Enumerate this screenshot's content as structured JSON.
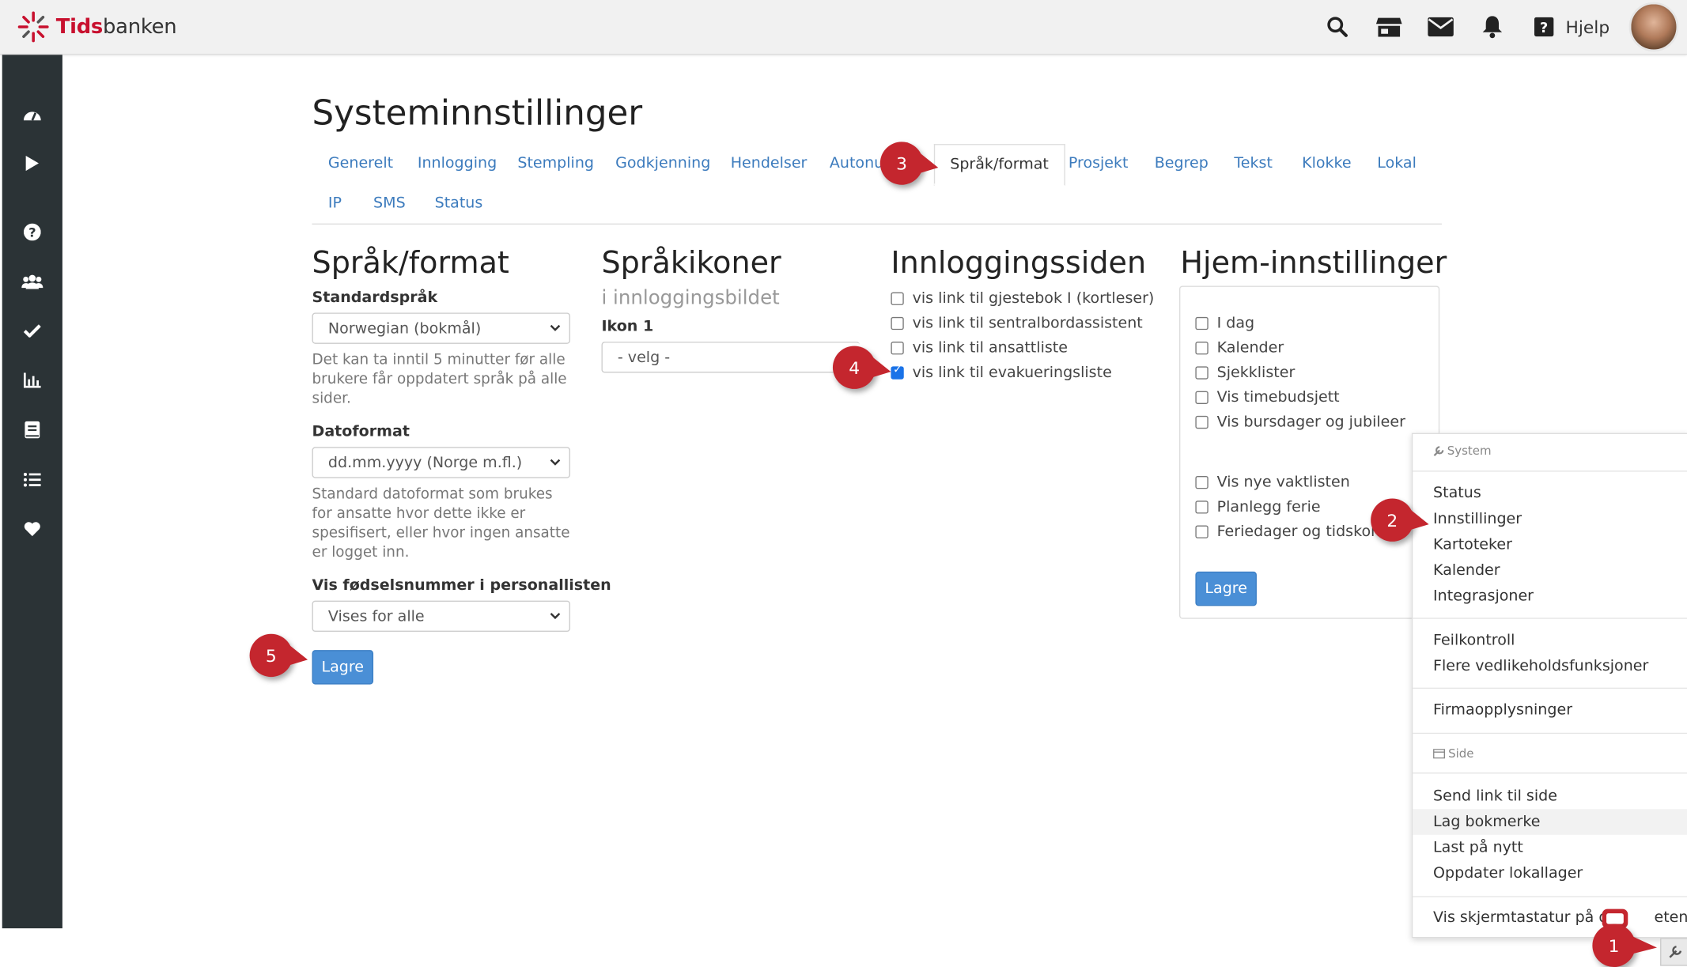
{
  "app": {
    "logo_text_a": "Tids",
    "logo_text_b": "banken",
    "help_label": "Hjelp"
  },
  "page": {
    "title": "Systeminnstillinger"
  },
  "tabs": [
    "Generelt",
    "Innlogging",
    "Stempling",
    "Godkjenning",
    "Hendelser",
    "Autonu",
    "Språk/format",
    "Prosjekt",
    "Begrep",
    "Tekst",
    "Klokke",
    "Lokal",
    "IP",
    "SMS",
    "Status"
  ],
  "active_tab": "Språk/format",
  "language": {
    "heading": "Språk/format",
    "std_label": "Standardspråk",
    "std_value": "Norwegian (bokmål)",
    "std_help": "Det kan ta inntil 5 minutter før alle brukere får oppdatert språk på alle sider.",
    "date_label": "Datoformat",
    "date_value": "dd.mm.yyyy (Norge m.fl.)",
    "date_help": "Standard datoformat som brukes for ansatte hvor dette ikke er spesifisert, eller hvor ingen ansatte er logget inn.",
    "ssn_label": "Vis fødselsnummer i personallisten",
    "ssn_value": "Vises for alle",
    "save": "Lagre"
  },
  "icons": {
    "heading": "Språkikoner",
    "sub": "i innloggingsbildet",
    "icon1_label": "Ikon 1",
    "icon1_value": "- velg -"
  },
  "login": {
    "heading": "Innloggingssiden",
    "options": [
      {
        "label": "vis link til gjestebok I (kortleser)",
        "checked": false
      },
      {
        "label": "vis link til sentralbordassistent",
        "checked": false
      },
      {
        "label": "vis link til ansattliste",
        "checked": false
      },
      {
        "label": "vis link til evakueringsliste",
        "checked": true
      }
    ]
  },
  "home": {
    "heading": "Hjem-innstillinger",
    "group1": [
      "I dag",
      "Kalender",
      "Sjekklister",
      "Vis timebudsjett",
      "Vis bursdager og jubileer"
    ],
    "group2": [
      "Vis nye vaktlisten",
      "Planlegg ferie",
      "Feriedager og tidskonto"
    ],
    "save": "Lagre"
  },
  "menu": {
    "system_header": "System",
    "g1": [
      "Status",
      "Innstillinger",
      "Kartoteker",
      "Kalender",
      "Integrasjoner"
    ],
    "g2": [
      "Feilkontroll",
      "Flere vedlikeholdsfunksjoner"
    ],
    "g3": [
      "Firmaopplysninger"
    ],
    "side_header": "Side",
    "g4": [
      "Send link til side",
      "Lag bokmerke",
      "Last på nytt",
      "Oppdater lokallager"
    ],
    "g5_a": "Vis skjermtastatur på de",
    "g5_b": "eten"
  },
  "badges": [
    "1",
    "2",
    "3",
    "4",
    "5"
  ],
  "colors": {
    "accent": "#4a8fd6",
    "link": "#3c7bbd",
    "badge": "#c4262e",
    "sidebar": "#2b3336",
    "brand": "#c8102e"
  }
}
